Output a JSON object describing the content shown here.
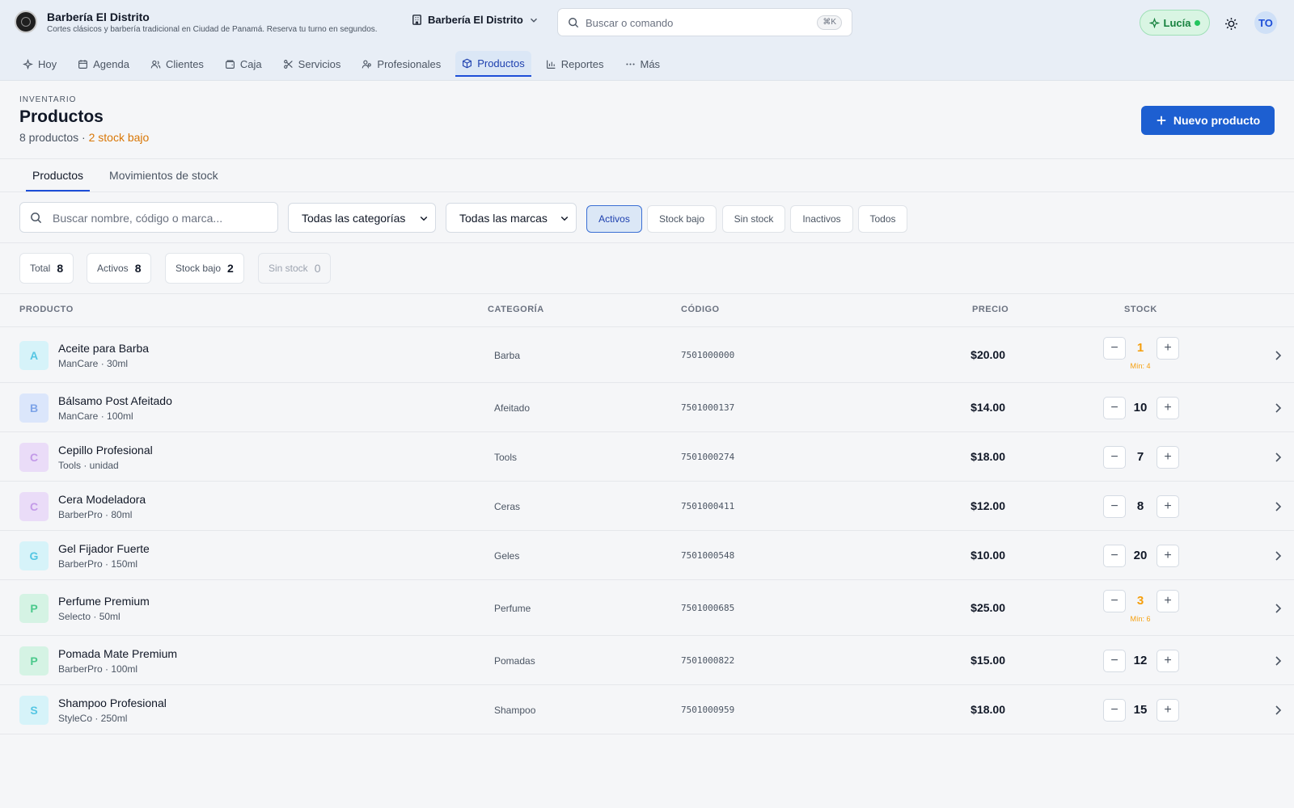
{
  "header": {
    "brand_name": "Barbería El Distrito",
    "brand_tagline": "Cortes clásicos y barbería tradicional en Ciudad de Panamá. Reserva tu turno en segundos.",
    "business_switch": "Barbería El Distrito",
    "command_placeholder": "Buscar o comando",
    "command_shortcut": "⌘K",
    "assistant_label": "Lucía",
    "avatar_initials": "TO"
  },
  "nav": {
    "items": [
      {
        "label": "Hoy",
        "icon": "sparkle-icon"
      },
      {
        "label": "Agenda",
        "icon": "calendar-icon"
      },
      {
        "label": "Clientes",
        "icon": "users-icon"
      },
      {
        "label": "Caja",
        "icon": "wallet-icon"
      },
      {
        "label": "Servicios",
        "icon": "scissors-icon"
      },
      {
        "label": "Profesionales",
        "icon": "user-group-icon"
      },
      {
        "label": "Productos",
        "icon": "package-icon",
        "active": true
      },
      {
        "label": "Reportes",
        "icon": "bar-chart-icon"
      },
      {
        "label": "Más",
        "icon": "dots-icon"
      }
    ]
  },
  "page": {
    "kicker": "INVENTARIO",
    "title": "Productos",
    "count_text": "8 productos ·",
    "low_stock_text": "2 stock bajo",
    "new_button": "Nuevo producto"
  },
  "tabs": [
    "Productos",
    "Movimientos de stock"
  ],
  "filters": {
    "search_placeholder": "Buscar nombre, código o marca...",
    "category_select": "Todas las categorías",
    "brand_select": "Todas las marcas",
    "chips": [
      "Activos",
      "Stock bajo",
      "Sin stock",
      "Inactivos",
      "Todos"
    ],
    "active_chip": "Activos"
  },
  "stats": [
    {
      "label": "Total",
      "value": "8"
    },
    {
      "label": "Activos",
      "value": "8"
    },
    {
      "label": "Stock bajo",
      "value": "2"
    },
    {
      "label": "Sin stock",
      "value": "0"
    }
  ],
  "table": {
    "headers": [
      "PRODUCTO",
      "CATEGORÍA",
      "CÓDIGO",
      "PRECIO",
      "STOCK"
    ],
    "rows": [
      {
        "initial": "A",
        "name": "Aceite para Barba",
        "meta": "ManCare · 30ml",
        "category": "Barba",
        "code": "7501000000",
        "price": "$20.00",
        "stock": "1",
        "min": "Mín: 4",
        "low": true,
        "bg": "#d6f3f9",
        "fg": "#55c6e3"
      },
      {
        "initial": "B",
        "name": "Bálsamo Post Afeitado",
        "meta": "ManCare · 100ml",
        "category": "Afeitado",
        "code": "7501000137",
        "price": "$14.00",
        "stock": "10",
        "min": "",
        "low": false,
        "bg": "#dbe6fb",
        "fg": "#7ea4e8"
      },
      {
        "initial": "C",
        "name": "Cepillo Profesional",
        "meta": "Tools · unidad",
        "category": "Tools",
        "code": "7501000274",
        "price": "$18.00",
        "stock": "7",
        "min": "",
        "low": false,
        "bg": "#eadcf8",
        "fg": "#c39ae8"
      },
      {
        "initial": "C",
        "name": "Cera Modeladora",
        "meta": "BarberPro · 80ml",
        "category": "Ceras",
        "code": "7501000411",
        "price": "$12.00",
        "stock": "8",
        "min": "",
        "low": false,
        "bg": "#eadcf8",
        "fg": "#c39ae8"
      },
      {
        "initial": "G",
        "name": "Gel Fijador Fuerte",
        "meta": "BarberPro · 150ml",
        "category": "Geles",
        "code": "7501000548",
        "price": "$10.00",
        "stock": "20",
        "min": "",
        "low": false,
        "bg": "#d6f3f9",
        "fg": "#55c6e3"
      },
      {
        "initial": "P",
        "name": "Perfume Premium",
        "meta": "Selecto · 50ml",
        "category": "Perfume",
        "code": "7501000685",
        "price": "$25.00",
        "stock": "3",
        "min": "Mín: 6",
        "low": true,
        "bg": "#d5f3e4",
        "fg": "#4cc98c"
      },
      {
        "initial": "P",
        "name": "Pomada Mate Premium",
        "meta": "BarberPro · 100ml",
        "category": "Pomadas",
        "code": "7501000822",
        "price": "$15.00",
        "stock": "12",
        "min": "",
        "low": false,
        "bg": "#d5f3e4",
        "fg": "#4cc98c"
      },
      {
        "initial": "S",
        "name": "Shampoo Profesional",
        "meta": "StyleCo · 250ml",
        "category": "Shampoo",
        "code": "7501000959",
        "price": "$18.00",
        "stock": "15",
        "min": "",
        "low": false,
        "bg": "#d6f3f9",
        "fg": "#55c6e3"
      }
    ]
  }
}
